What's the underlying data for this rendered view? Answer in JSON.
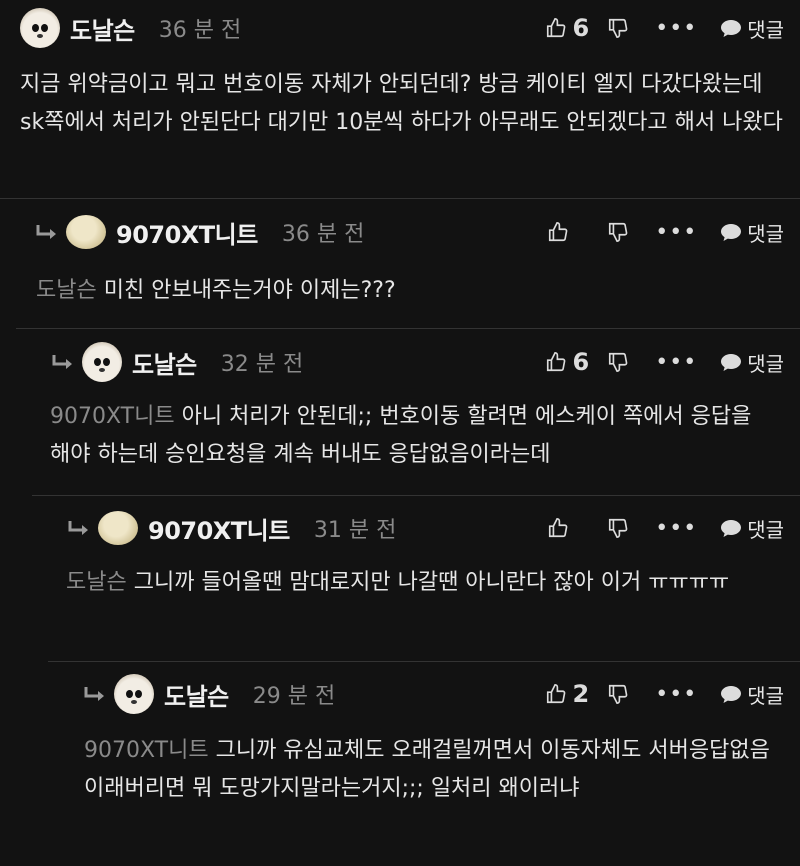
{
  "comments": [
    {
      "nick": "도날슨",
      "time": "36 분 전",
      "likes": "6",
      "mention": "",
      "text": "지금 위약금이고 뭐고 번호이동 자체가 안되던데? 방금 케이티 엘지 다갔다왔는데 sk쪽에서 처리가 안된단다 대기만 10분씩 하다가 아무래도 안되겠다고 해서 나왔다",
      "reply_label": "댓글"
    },
    {
      "nick": "9070XT니트",
      "time": "36 분 전",
      "likes": "",
      "mention": "도날슨",
      "text": "미친 안보내주는거야 이제는???",
      "reply_label": "댓글"
    },
    {
      "nick": "도날슨",
      "time": "32 분 전",
      "likes": "6",
      "mention": "9070XT니트",
      "text": "아니 처리가 안된데;; 번호이동 할려면 에스케이 쪽에서 응답을 해야 하는데 승인요청을 계속 버내도 응답없음이라는데",
      "reply_label": "댓글"
    },
    {
      "nick": "9070XT니트",
      "time": "31 분 전",
      "likes": "",
      "mention": "도날슨",
      "text": "그니까 들어올땐 맘대로지만 나갈땐 아니란다 잖아 이거 ㅠㅠㅠㅠ",
      "reply_label": "댓글"
    },
    {
      "nick": "도날슨",
      "time": "29 분 전",
      "likes": "2",
      "mention": "9070XT니트",
      "text": "그니까 유심교체도 오래걸릴꺼면서 이동자체도 서버응답없음 이래버리면 뭐 도망가지말라는거지;;; 일처리 왜이러냐",
      "reply_label": "댓글"
    }
  ],
  "icons": {
    "like": "thumbs-up-icon",
    "dislike": "thumbs-down-icon",
    "more": "more-icon",
    "reply": "speech-bubble-icon",
    "reply_arrow": "reply-arrow-icon"
  },
  "colors": {
    "background": "#121212",
    "text": "#e6e6e6",
    "muted": "#8a8a8a",
    "divider": "#333333"
  }
}
